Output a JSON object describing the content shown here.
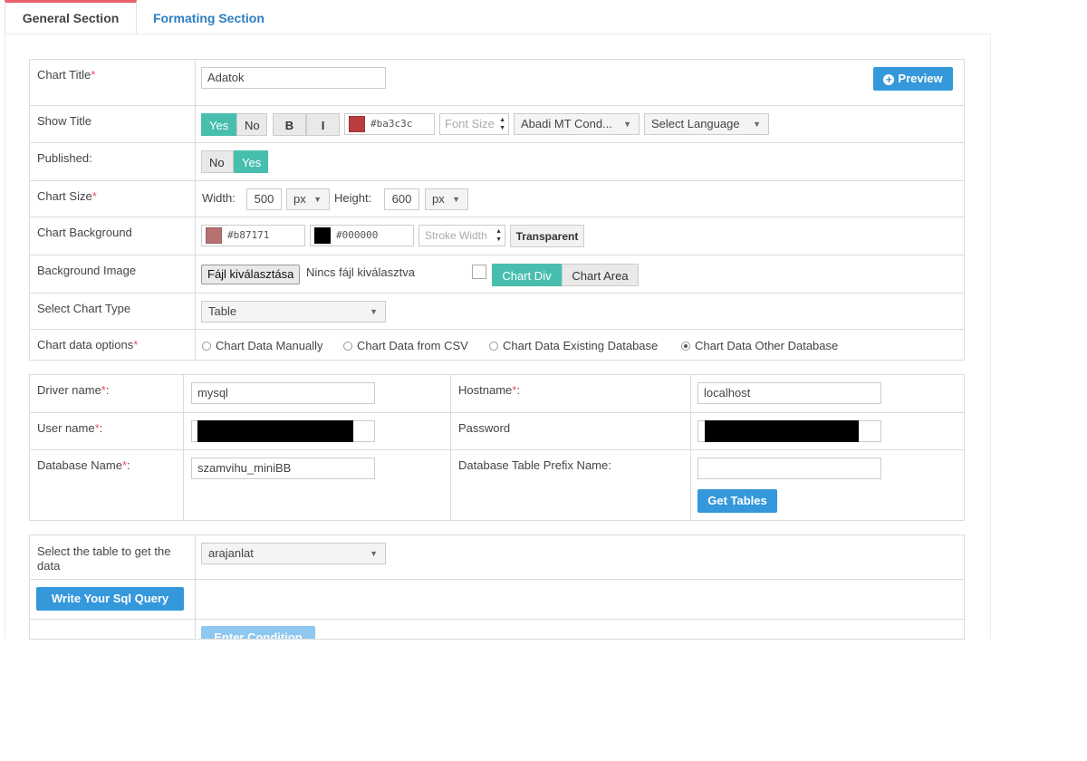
{
  "tabs": [
    {
      "label": "General Section",
      "active": true
    },
    {
      "label": "Formating Section",
      "active": false
    }
  ],
  "general": {
    "chart_title": {
      "label": "Chart Title",
      "value": "Adatok",
      "preview_label": "Preview"
    },
    "show_title": {
      "label": "Show Title",
      "yes": "Yes",
      "no": "No",
      "bold": "B",
      "italic": "I",
      "color": "#ba3c3c",
      "font_size_placeholder": "Font Size",
      "font_family": "Abadi MT Cond...",
      "language": "Select Language"
    },
    "published": {
      "label": "Published:",
      "no": "No",
      "yes": "Yes"
    },
    "chart_size": {
      "label": "Chart Size",
      "width_label": "Width:",
      "width": "500",
      "width_unit": "px",
      "height_label": "Height:",
      "height": "600",
      "height_unit": "px"
    },
    "chart_background": {
      "label": "Chart Background",
      "bg_color": "#b87171",
      "stroke_color": "#000000",
      "stroke_placeholder": "Stroke Width",
      "transparent": "Transparent"
    },
    "background_image": {
      "label": "Background Image",
      "file_button": "Fájl kiválasztása",
      "file_status": "Nincs fájl kiválasztva",
      "chart_div": "Chart Div",
      "chart_area": "Chart Area"
    },
    "chart_type": {
      "label": "Select Chart Type",
      "value": "Table"
    },
    "data_options": {
      "label": "Chart data options",
      "options": [
        "Chart Data Manually",
        "Chart Data from CSV",
        "Chart Data Existing Database",
        "Chart Data Other Database"
      ],
      "selected": 3
    }
  },
  "database": {
    "driver_label": "Driver name",
    "driver": "mysql",
    "host_label": "Hostname",
    "host": "localhost",
    "user_label": "User name",
    "password_label": "Password",
    "dbname_label": "Database Name",
    "dbname": "szamvihu_miniBB",
    "prefix_label": "Database Table Prefix Name",
    "get_tables": "Get Tables"
  },
  "table_select": {
    "label": "Select the table to get the data",
    "value": "arajanlat",
    "sql_button": "Write Your Sql Query",
    "condition_button": "Enter Condition"
  },
  "colors": {
    "accent": "#48bfae",
    "primary": "#3498db",
    "required": "#e8505b",
    "tab_active": "#e8626b"
  }
}
